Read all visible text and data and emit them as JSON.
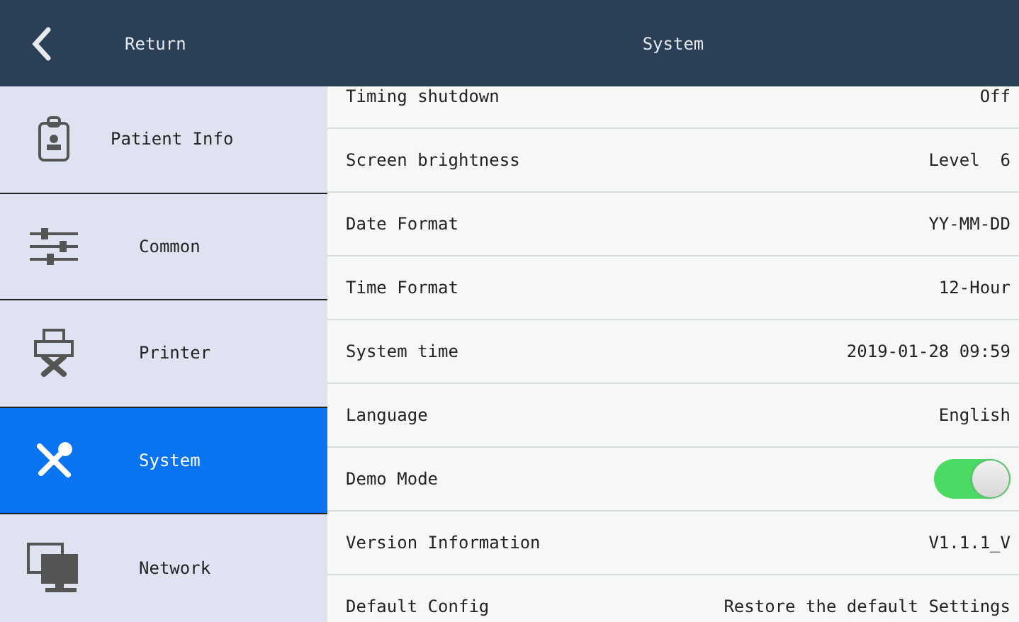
{
  "header": {
    "back_label": "Return",
    "title": "System"
  },
  "sidebar": {
    "items": [
      {
        "label": "Patient Info",
        "selected": false
      },
      {
        "label": "Common",
        "selected": false
      },
      {
        "label": "Printer",
        "selected": false
      },
      {
        "label": "System",
        "selected": true
      },
      {
        "label": "Network",
        "selected": false
      }
    ]
  },
  "settings": [
    {
      "kind": "value",
      "label": "Timing shutdown",
      "value": "Off"
    },
    {
      "kind": "value",
      "label": "Screen brightness",
      "value": "Level  6"
    },
    {
      "kind": "value",
      "label": "Date Format",
      "value": "YY-MM-DD"
    },
    {
      "kind": "value",
      "label": "Time Format",
      "value": "12-Hour"
    },
    {
      "kind": "value",
      "label": "System time",
      "value": "2019-01-28 09:59"
    },
    {
      "kind": "value",
      "label": "Language",
      "value": "English"
    },
    {
      "kind": "toggle",
      "label": "Demo Mode",
      "on": true
    },
    {
      "kind": "value",
      "label": "Version Information",
      "value": "V1.1.1_V"
    },
    {
      "kind": "value",
      "label": "Default Config",
      "value": "Restore the default Settings"
    }
  ]
}
